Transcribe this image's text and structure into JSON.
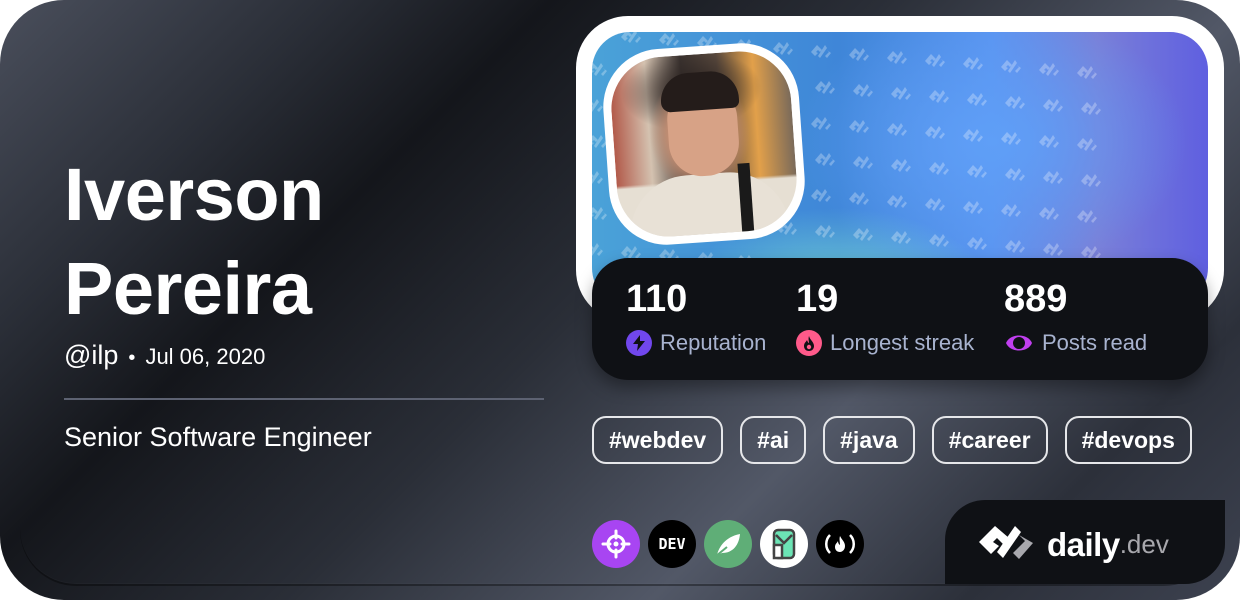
{
  "profile": {
    "first_name": "Iverson",
    "last_name": "Pereira",
    "handle": "@ilp",
    "separator": "•",
    "joined": "Jul 06, 2020",
    "title": "Senior Software Engineer",
    "avatar_alt": "Profile photo of Iverson Pereira"
  },
  "stats": [
    {
      "value": "110",
      "label": "Reputation",
      "icon": "lightning-icon",
      "color": "#7147ed"
    },
    {
      "value": "19",
      "label": "Longest streak",
      "icon": "flame-icon",
      "color": "#ff5a8a"
    },
    {
      "value": "889",
      "label": "Posts read",
      "icon": "eye-icon",
      "color": "#c03fef"
    }
  ],
  "tags": [
    "#webdev",
    "#ai",
    "#java",
    "#career",
    "#devops"
  ],
  "sources": [
    {
      "name": "crosshair-source-icon",
      "bg": "#a845f2"
    },
    {
      "name": "dev-to-source-icon",
      "bg": "#000000",
      "text": "DEV"
    },
    {
      "name": "leaf-source-icon",
      "bg": "#5fae77"
    },
    {
      "name": "owl-source-icon",
      "bg": "#ffffff"
    },
    {
      "name": "freecodecamp-source-icon",
      "bg": "#000000",
      "text": "(🔥)"
    }
  ],
  "brand": {
    "word": "daily",
    "tld": ".dev"
  },
  "colors": {
    "card_dark": "#0f1115",
    "stat_label": "#a8b3cf",
    "accent_reputation": "#7147ed",
    "accent_streak": "#ff5a8a",
    "accent_posts": "#c03fef"
  }
}
